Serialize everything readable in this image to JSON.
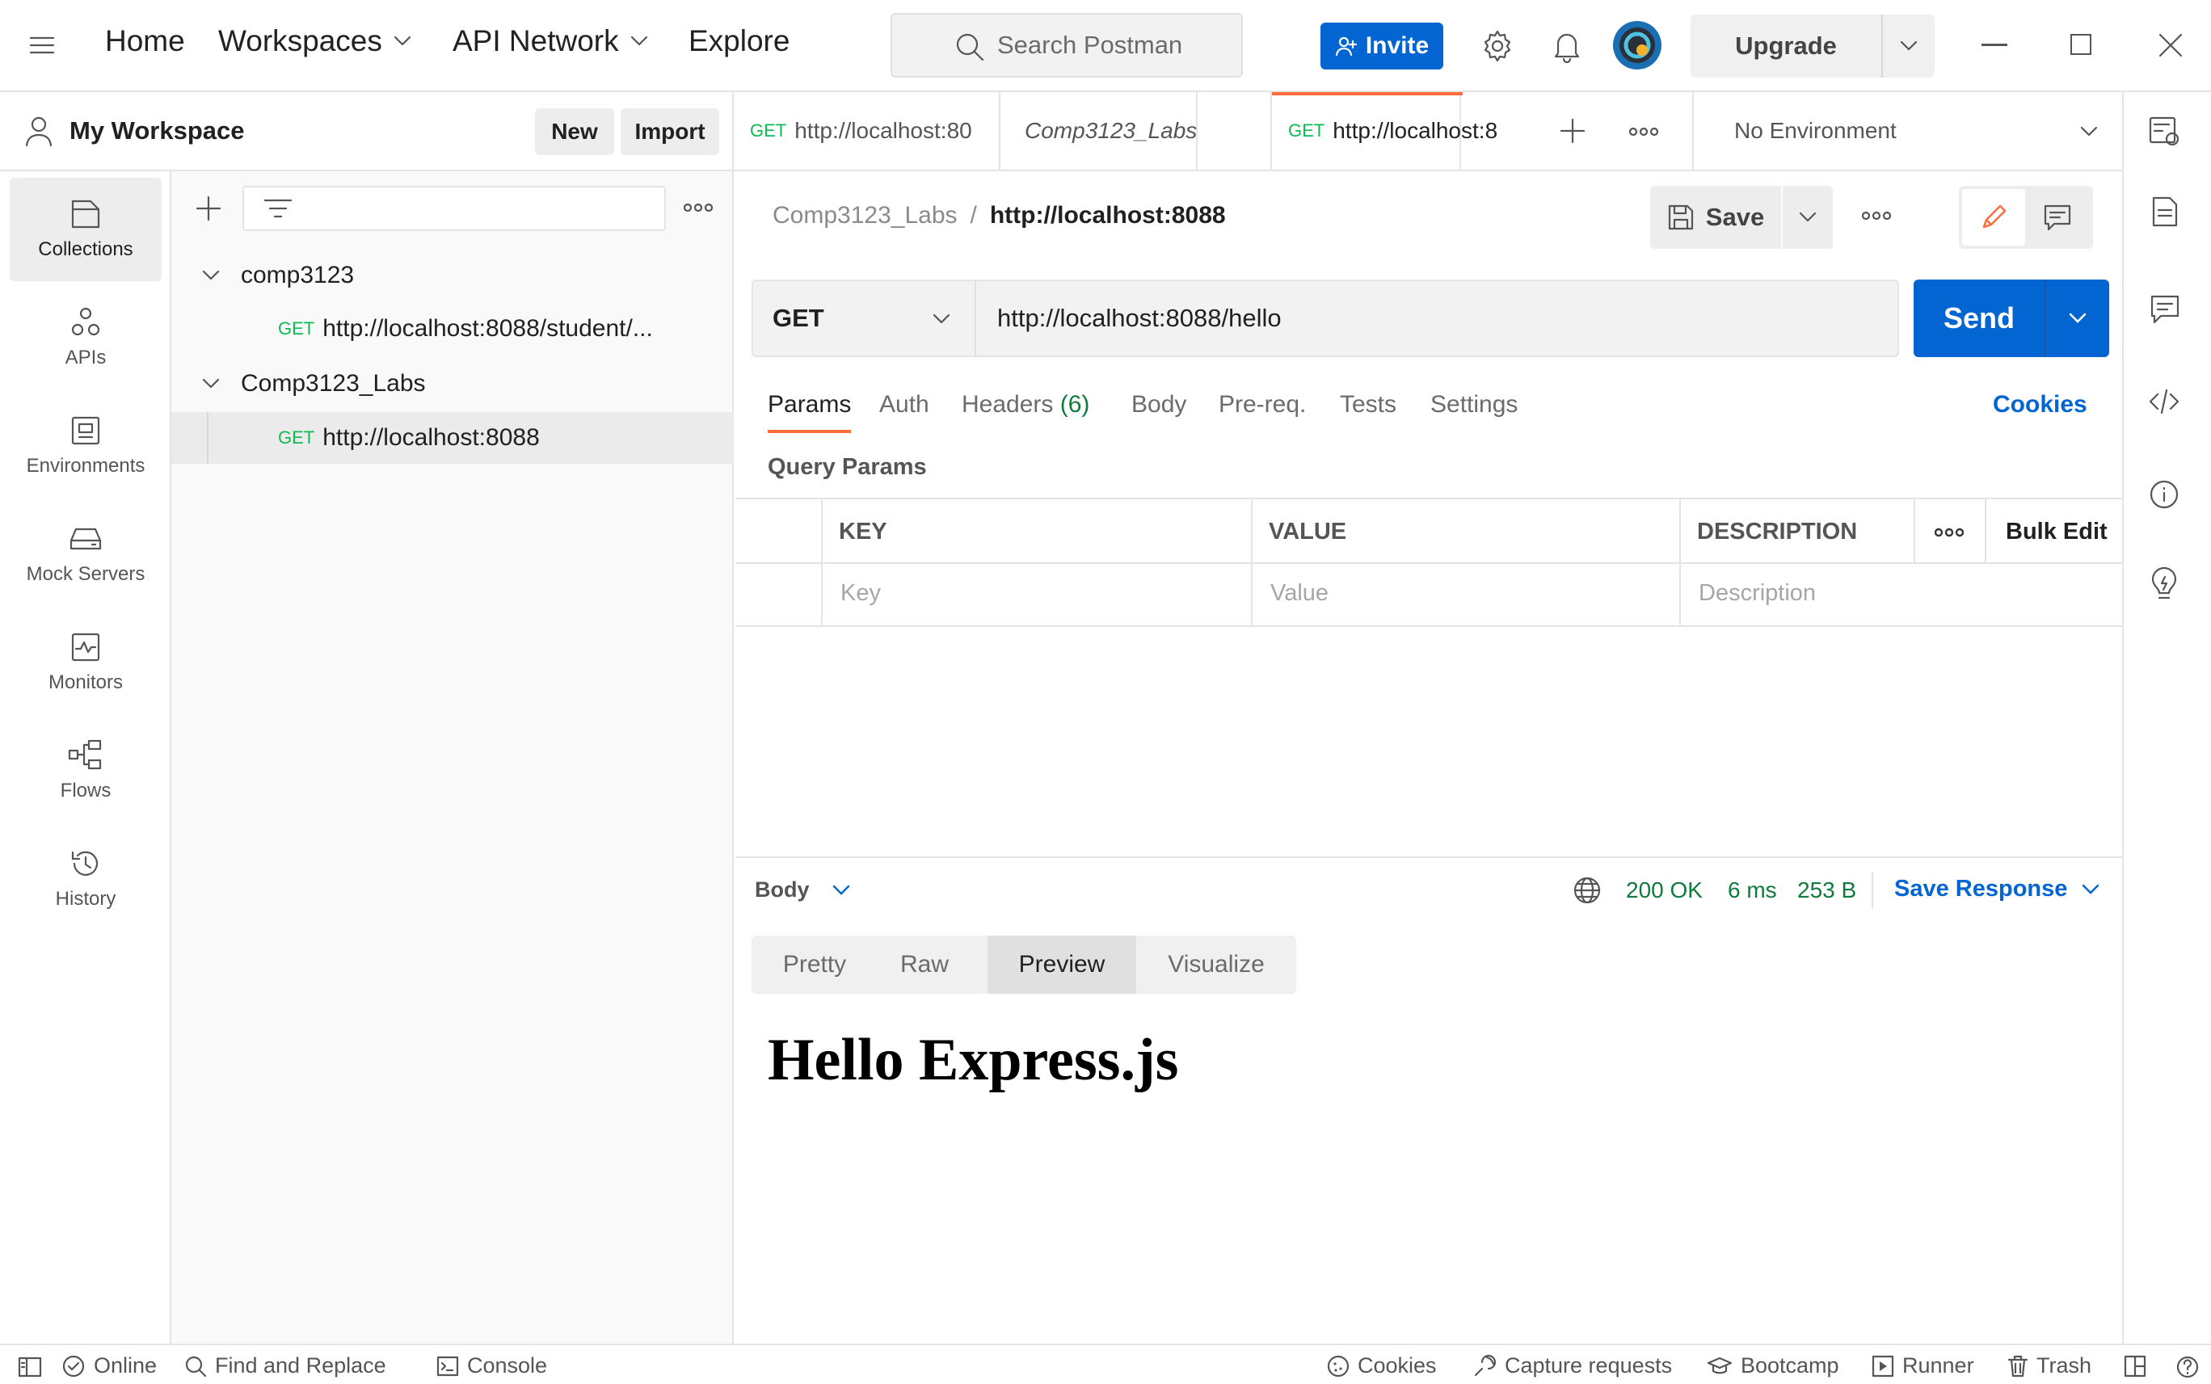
{
  "topbar": {
    "nav": [
      "Home",
      "Workspaces",
      "API Network",
      "Explore"
    ],
    "search_placeholder": "Search Postman",
    "invite_label": "Invite",
    "upgrade_label": "Upgrade"
  },
  "workspace": {
    "title": "My Workspace",
    "new_label": "New",
    "import_label": "Import"
  },
  "rail": {
    "items": [
      "Collections",
      "APIs",
      "Environments",
      "Mock Servers",
      "Monitors",
      "Flows",
      "History"
    ]
  },
  "sidebar": {
    "collections": [
      {
        "name": "comp3123",
        "requests": [
          {
            "method": "GET",
            "url": "http://localhost:8088/student/..."
          }
        ]
      },
      {
        "name": "Comp3123_Labs",
        "requests": [
          {
            "method": "GET",
            "url": "http://localhost:8088"
          }
        ]
      }
    ]
  },
  "tabs": [
    {
      "method": "GET",
      "label": "http://localhost:80"
    },
    {
      "method": "",
      "label": "Comp3123_Labs"
    },
    {
      "method": "GET",
      "label": "http://localhost:8"
    }
  ],
  "environment": "No Environment",
  "breadcrumb": {
    "collection": "Comp3123_Labs",
    "separator": "/",
    "request": "http://localhost:8088"
  },
  "save_label": "Save",
  "request": {
    "method": "GET",
    "url": "http://localhost:8088/hello",
    "send_label": "Send"
  },
  "request_tabs": {
    "params": "Params",
    "auth": "Auth",
    "headers": "Headers",
    "headers_count": "(6)",
    "body": "Body",
    "prereq": "Pre-req.",
    "tests": "Tests",
    "settings": "Settings",
    "cookies": "Cookies"
  },
  "query_params": {
    "title": "Query Params",
    "headers": [
      "KEY",
      "VALUE",
      "DESCRIPTION"
    ],
    "bulk_edit": "Bulk Edit",
    "placeholders": [
      "Key",
      "Value",
      "Description"
    ]
  },
  "response": {
    "body_label": "Body",
    "status": "200 OK",
    "time": "6 ms",
    "size": "253 B",
    "save_response": "Save Response",
    "views": [
      "Pretty",
      "Raw",
      "Preview",
      "Visualize"
    ],
    "active_view": "Preview",
    "preview_text": "Hello Express.js"
  },
  "statusbar": {
    "online": "Online",
    "find_replace": "Find and Replace",
    "console": "Console",
    "cookies": "Cookies",
    "capture": "Capture requests",
    "bootcamp": "Bootcamp",
    "runner": "Runner",
    "trash": "Trash"
  },
  "colors": {
    "accent": "#0265d2",
    "get": "#0cbb52",
    "orange": "#ff6c37",
    "status_ok": "#0f7b3c"
  }
}
